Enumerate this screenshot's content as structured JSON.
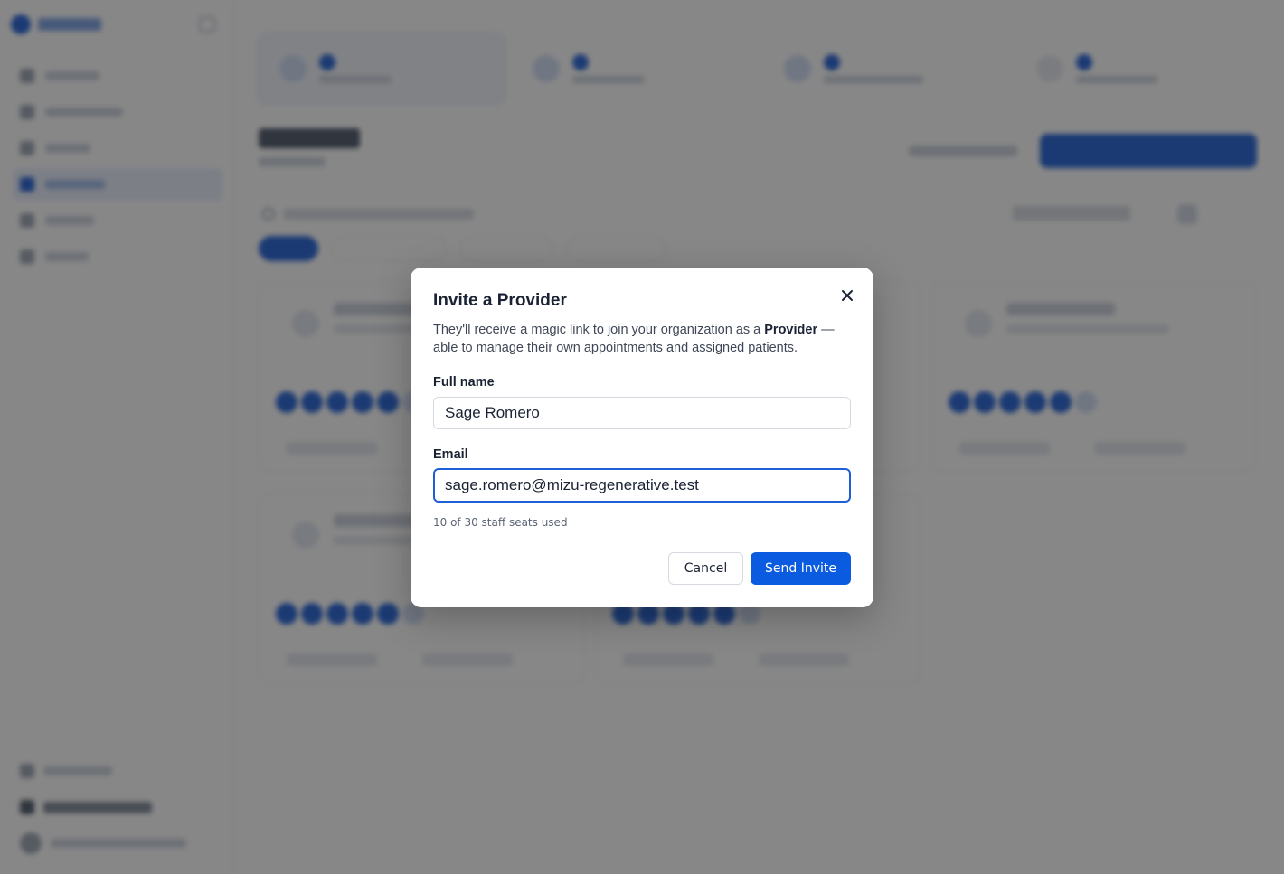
{
  "modal": {
    "title": "Invite a Provider",
    "description_before": "They'll receive a magic link to join your organization as a ",
    "description_role": "Provider",
    "description_after": " — able to manage their own appointments and assigned patients.",
    "full_name_label": "Full name",
    "full_name_value": "Sage Romero",
    "email_label": "Email",
    "email_value": "sage.romero@mizu-regenerative.test",
    "seats_text": "10 of 30 staff seats used",
    "cancel_label": "Cancel",
    "send_label": "Send Invite",
    "close_icon": "close-icon"
  },
  "colors": {
    "primary": "#0a5be0",
    "overlay": "rgba(25,25,25,0.52)",
    "focus_ring": "#1f5fd6"
  }
}
